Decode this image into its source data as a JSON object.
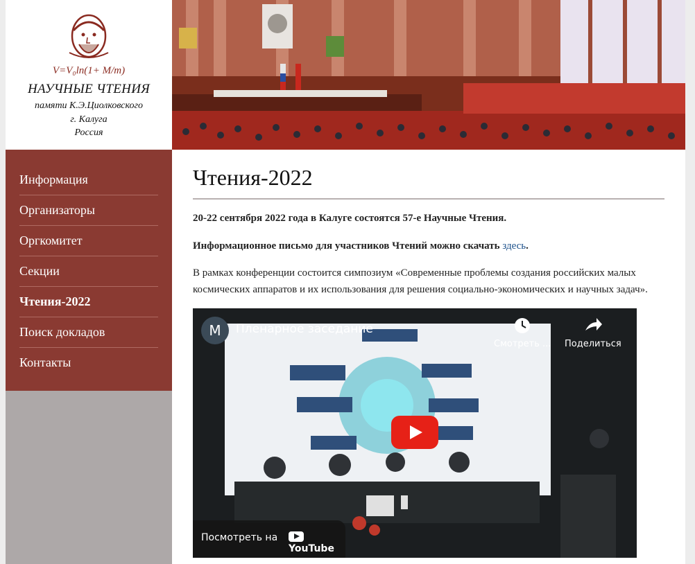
{
  "logo": {
    "title": "НАУЧНЫЕ ЧТЕНИЯ",
    "subtitle": "памяти К.Э.Циолковского",
    "city": "г. Калуга",
    "country": "Россия",
    "formula_text": "V=V₀ln(1+ M/m)"
  },
  "nav": {
    "items": [
      {
        "label": "Информация"
      },
      {
        "label": "Организаторы"
      },
      {
        "label": "Оргкомитет"
      },
      {
        "label": "Секции"
      },
      {
        "label": "Чтения-2022"
      },
      {
        "label": "Поиск докладов"
      },
      {
        "label": "Контакты"
      }
    ],
    "active_index": 4
  },
  "content": {
    "title": "Чтения-2022",
    "p1": "20-22 сентября 2022 года в Калуге состоятся 57-е Научные Чтения.",
    "p2_text": "Информационное письмо для участников Чтений можно скачать",
    "p2_link": "здесь",
    "p2_end": ".",
    "p3": "В рамках конференции состоится симпозиум «Современные проблемы создания российских малых космических аппаратов и их использования для решения социально-экономических и научных задач»."
  },
  "video": {
    "channel_initial": "M",
    "title": "Пленарное заседание",
    "watch_later": "Смотреть ...",
    "share": "Поделиться",
    "watch_on": "Посмотреть на",
    "youtube": "YouTube"
  },
  "colors": {
    "nav_bg": "#8a3a32",
    "sidebar_bg": "#ada8a8",
    "link": "#1a4f8a",
    "play": "#e62117"
  }
}
